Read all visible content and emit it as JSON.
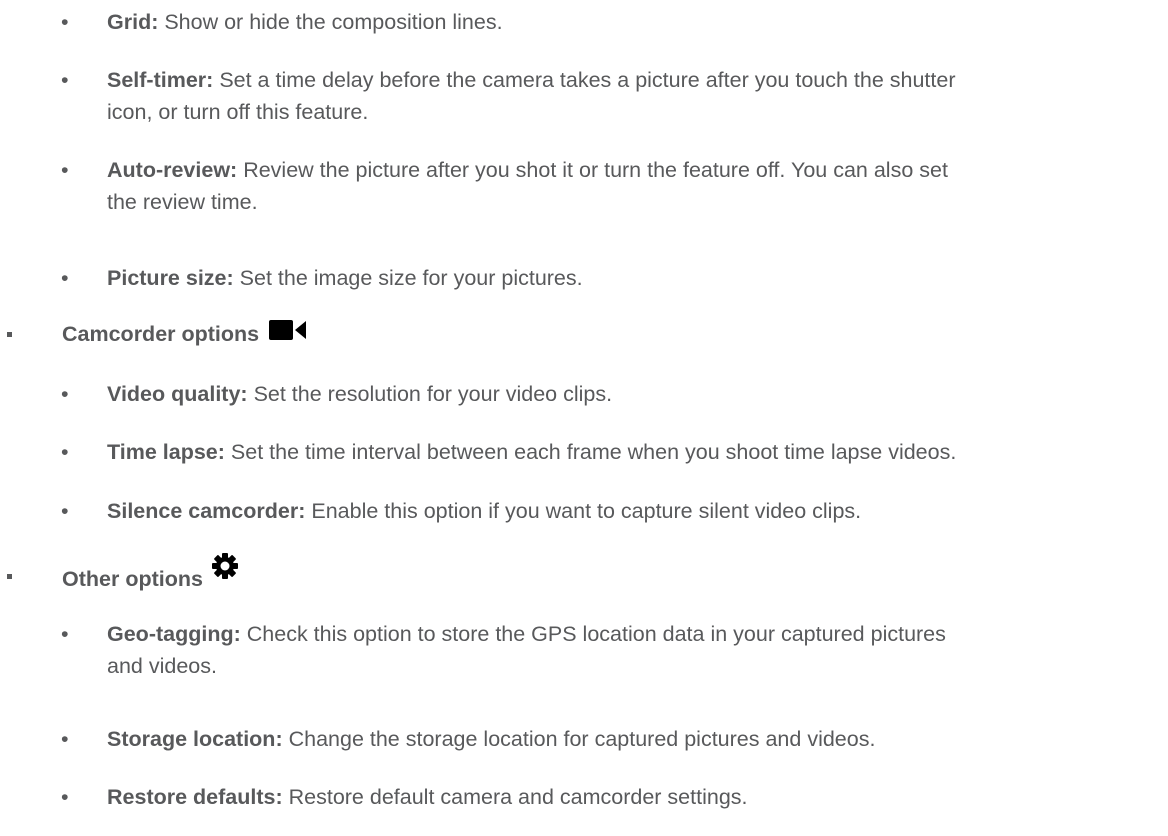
{
  "groups": [
    {
      "items": [
        {
          "term": "Grid:",
          "desc": "Show or hide the composition lines."
        },
        {
          "term": "Self-timer:",
          "desc": "Set a time delay before the camera takes a picture after you touch the shutter",
          "desc2": "icon, or turn off this feature."
        },
        {
          "term": "Auto-review:",
          "desc": "Review the picture after you shot it or turn the feature off. You can also set",
          "desc2": "the review time."
        },
        {
          "term": "Picture size:",
          "desc": "Set the image size for your pictures."
        }
      ]
    },
    {
      "title": "Camcorder options",
      "icon": "video-camera-icon",
      "items": [
        {
          "term": "Video quality:",
          "desc": "Set the resolution for your video clips."
        },
        {
          "term": "Time lapse:",
          "desc": "Set the time interval between each frame when you shoot time lapse videos."
        },
        {
          "term": "Silence camcorder:",
          "desc": "Enable this option if you want to capture silent video clips."
        }
      ]
    },
    {
      "title": "Other options",
      "icon": "gear-icon",
      "items": [
        {
          "term": "Geo-tagging:",
          "desc": "Check this option to store the GPS location data in your captured pictures",
          "desc2": "and videos."
        },
        {
          "term": "Storage location:",
          "desc": "Change the storage location for captured pictures and videos."
        },
        {
          "term": "Restore defaults:",
          "desc": "Restore default camera and camcorder settings."
        }
      ]
    }
  ],
  "bullet": "•"
}
